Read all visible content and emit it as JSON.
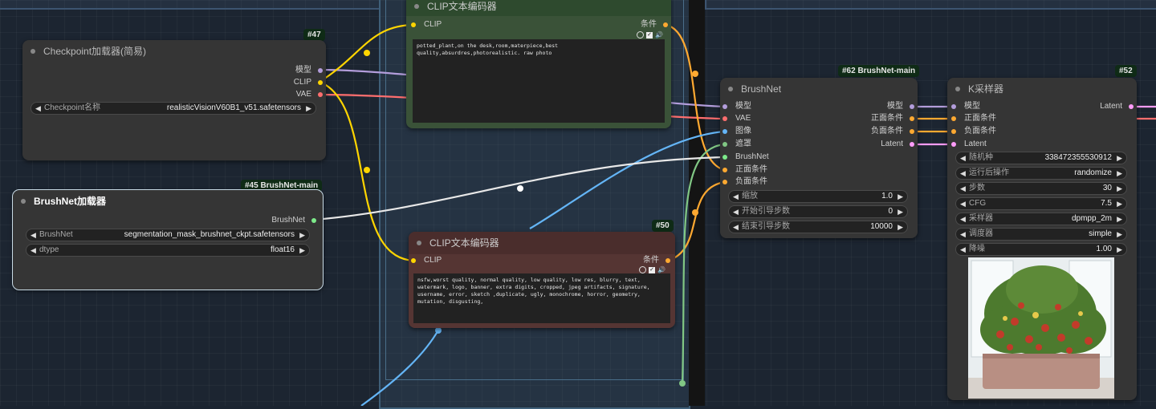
{
  "colors": {
    "model": "#b39ddb",
    "clip": "#ffd500",
    "vae": "#ff6e6e",
    "conditioning": "#ffa931",
    "image": "#64b5f6",
    "mask": "#81c784",
    "brushnet": "#7dea8a",
    "latent": "#ff9cf9"
  },
  "checkpoint_node": {
    "badge": "#47",
    "title": "Checkpoint加载器(简易)",
    "outputs": [
      "模型",
      "CLIP",
      "VAE"
    ],
    "widget_label": "Checkpoint名称",
    "widget_value": "realisticVisionV60B1_v51.safetensors"
  },
  "brushnet_loader": {
    "badge": "#45 BrushNet-main",
    "title": "BrushNet加载器",
    "output": "BrushNet",
    "widgets": [
      {
        "label": "BrushNet",
        "value": "segmentation_mask_brushnet_ckpt.safetensors"
      },
      {
        "label": "dtype",
        "value": "float16"
      }
    ]
  },
  "clip_positive": {
    "title": "CLIP文本编码器",
    "input": "CLIP",
    "output": "条件",
    "text": "potted_plant,on the desk,room,materpiece,best quality,absurdres,photorealistic. raw photo"
  },
  "clip_negative": {
    "badge": "#50",
    "title": "CLIP文本编码器",
    "input": "CLIP",
    "output": "条件",
    "text": "nsfw,worst quality, normal quality, low quality, low res, blurry, text, watermark, logo, banner, extra digits, cropped, jpeg artifacts, signature, username, error, sketch ,duplicate, ugly, monochrome, horror, geometry, mutation, disgusting,"
  },
  "brushnet_node": {
    "badge": "#62 BrushNet-main",
    "title": "BrushNet",
    "inputs": [
      "模型",
      "VAE",
      "图像",
      "遮罩",
      "BrushNet",
      "正面条件",
      "负面条件"
    ],
    "outputs": [
      "模型",
      "正面条件",
      "负面条件",
      "Latent"
    ],
    "widgets": [
      {
        "label": "缩放",
        "value": "1.0"
      },
      {
        "label": "开始引导步数",
        "value": "0"
      },
      {
        "label": "结束引导步数",
        "value": "10000"
      }
    ]
  },
  "ksampler_node": {
    "badge": "#52",
    "title": "K采样器",
    "inputs": [
      "模型",
      "正面条件",
      "负面条件",
      "Latent"
    ],
    "output": "Latent",
    "widgets": [
      {
        "label": "随机种",
        "value": "338472355530912"
      },
      {
        "label": "运行后操作",
        "value": "randomize"
      },
      {
        "label": "步数",
        "value": "30"
      },
      {
        "label": "CFG",
        "value": "7.5"
      },
      {
        "label": "采样器",
        "value": "dpmpp_2m"
      },
      {
        "label": "调度器",
        "value": "simple"
      },
      {
        "label": "降噪",
        "value": "1.00"
      }
    ],
    "preview_alt": "potted-plant-preview"
  }
}
